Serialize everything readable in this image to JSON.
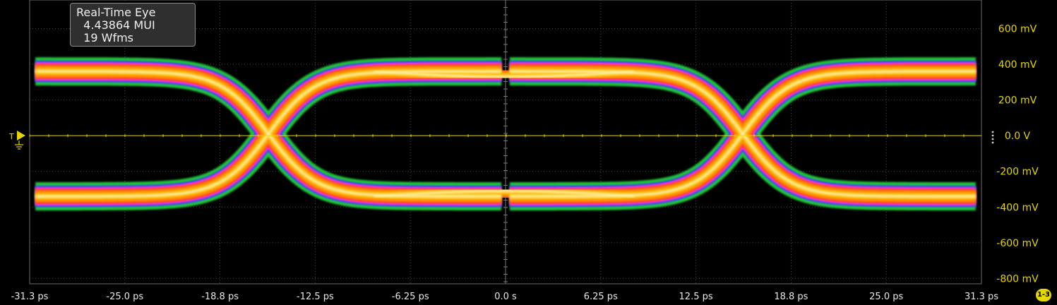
{
  "measurement": {
    "title": "Real-Time Eye",
    "ui_count": "4.43864 MUI",
    "waveforms": "19 Wfms"
  },
  "channel_badge": "1-3",
  "trigger_marker_label": "T",
  "colors": {
    "background": "#000000",
    "axis_label": "#e6d600",
    "time_label": "#e8e8e8",
    "zero_line": "#e6d600",
    "grid": "#4a4a4a"
  },
  "icons": [
    "trigger-arrow-icon",
    "ground-icon",
    "scale-handle-icon"
  ],
  "chart_data": {
    "type": "heatmap",
    "title": "",
    "xlabel": "",
    "ylabel": "",
    "x_ticks": [
      "-31.3 ps",
      "-25.0 ps",
      "-18.8 ps",
      "-12.5 ps",
      "-6.25 ps",
      "0.0 s",
      "6.25 ps",
      "12.5 ps",
      "18.8 ps",
      "25.0 ps",
      "31.3 ps"
    ],
    "y_ticks": [
      "600 mV",
      "400 mV",
      "200 mV",
      "0.0 V",
      "-200 mV",
      "-400 mV",
      "-600 mV",
      "-800 mV"
    ],
    "x_range_ps": [
      -31.3,
      31.3
    ],
    "y_range_mV": [
      -830,
      760
    ],
    "grid": true,
    "eye": {
      "high_level_mV": 360,
      "low_level_mV": -340,
      "crossings_ps": [
        -15.6,
        15.6
      ],
      "period_ps": 31.3,
      "eye_opening_top_mV": 300,
      "eye_opening_bottom_mV": -290
    }
  }
}
